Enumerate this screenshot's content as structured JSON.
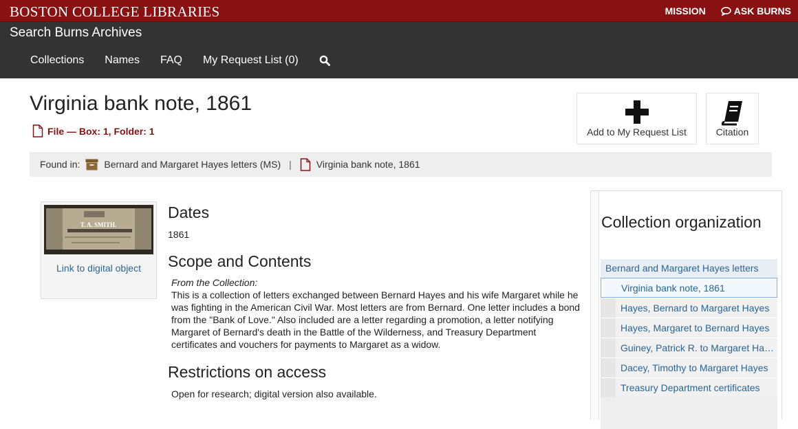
{
  "topbar": {
    "brand": "BOSTON COLLEGE LIBRARIES",
    "mission": "MISSION",
    "ask": "ASK BURNS"
  },
  "header": {
    "site_title": "Search Burns Archives",
    "nav": [
      "Collections",
      "Names",
      "FAQ",
      "My Request List (0)"
    ]
  },
  "record": {
    "title": "Virginia bank note, 1861",
    "subtitle": "File — Box: 1, Folder: 1"
  },
  "actions": {
    "add": "Add to My Request List",
    "citation": "Citation"
  },
  "breadcrumb": {
    "found_in": "Found in:",
    "collection": "Bernard and Margaret Hayes letters (MS)",
    "separator": "|",
    "current": "Virginia bank note, 1861"
  },
  "thumbnail": {
    "link": "Link to digital object",
    "note_text": "T. A. SMITH."
  },
  "sections": {
    "dates_heading": "Dates",
    "dates_value": "1861",
    "scope_heading": "Scope and Contents",
    "scope_from": "From the Collection:",
    "scope_text": "This is a collection of letters exchanged between Bernard Hayes and his wife Margaret while he was fighting in the American Civil War. Most letters are from Bernard. One letter includes a bond from the \"Bank of Love.\" Also included are a letter regarding a promotion, a letter notifying Margaret of Bernard's death in the Battle of the Wilderness, and Treasury Department certificates and vouchers for payments to Margaret as a widow.",
    "restrictions_heading": "Restrictions on access",
    "restrictions_text": "Open for research; digital version also available."
  },
  "sidebar": {
    "title": "Collection organization",
    "root": "Bernard and Margaret Hayes letters",
    "items": [
      "Virginia bank note, 1861",
      "Hayes, Bernard to Margaret Hayes",
      "Hayes, Margaret to Bernard Hayes",
      "Guiney, Patrick R. to Margaret Hayes",
      "Dacey, Timothy to Margaret Hayes",
      "Treasury Department certificates"
    ]
  },
  "colors": {
    "maroon": "#8a1111",
    "dark": "#333333",
    "link": "#2a6496"
  }
}
